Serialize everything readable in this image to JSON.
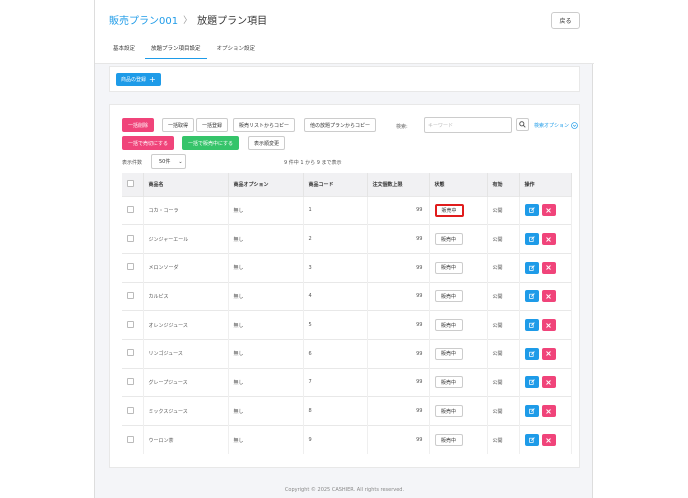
{
  "breadcrumb": {
    "parent": "販売プラン001",
    "separator": "〉",
    "current": "放題プラン項目"
  },
  "back_label": "戻る",
  "tabs": [
    {
      "label": "基本設定"
    },
    {
      "label": "放題プラン項目設定"
    },
    {
      "label": "オプション設定"
    }
  ],
  "register_button": {
    "label": "商品の登録",
    "icon": "plus-icon"
  },
  "toolbar": {
    "bulk_delete": "一括削除",
    "bulk_fetch": "一括取得",
    "bulk_register": "一括登録",
    "copy_from_sales_list": "販売リストからコピー",
    "copy_from_other_plan": "他の放題プランからコピー",
    "bulk_sold_out": "一括で売切にする",
    "bulk_on_sale": "一括で販売中にする",
    "reorder": "表示順変更"
  },
  "search": {
    "label": "検索:",
    "placeholder": "キーワード",
    "options_label": "検索オプション"
  },
  "display_count": {
    "label": "表示件数",
    "value": "50件"
  },
  "result_summary": "9 件中 1 から 9 まで表示",
  "table": {
    "headers": [
      "",
      "商品名",
      "商品オプション",
      "商品コード",
      "注文個数上限",
      "状態",
      "有効",
      "操作"
    ],
    "rows": [
      {
        "name": "コカ・コーラ",
        "option": "無し",
        "code": "1",
        "limit": "99",
        "status": "販売中",
        "active": "公開"
      },
      {
        "name": "ジンジャーエール",
        "option": "無し",
        "code": "2",
        "limit": "99",
        "status": "販売中",
        "active": "公開"
      },
      {
        "name": "メロンソーダ",
        "option": "無し",
        "code": "3",
        "limit": "99",
        "status": "販売中",
        "active": "公開"
      },
      {
        "name": "カルピス",
        "option": "無し",
        "code": "4",
        "limit": "99",
        "status": "販売中",
        "active": "公開"
      },
      {
        "name": "オレンジジュース",
        "option": "無し",
        "code": "5",
        "limit": "99",
        "status": "販売中",
        "active": "公開"
      },
      {
        "name": "リンゴジュース",
        "option": "無し",
        "code": "6",
        "limit": "99",
        "status": "販売中",
        "active": "公開"
      },
      {
        "name": "グレープジュース",
        "option": "無し",
        "code": "7",
        "limit": "99",
        "status": "販売中",
        "active": "公開"
      },
      {
        "name": "ミックスジュース",
        "option": "無し",
        "code": "8",
        "limit": "99",
        "status": "販売中",
        "active": "公開"
      },
      {
        "name": "ウーロン茶",
        "option": "無し",
        "code": "9",
        "limit": "99",
        "status": "販売中",
        "active": "公開"
      }
    ]
  },
  "colors": {
    "accent": "#1e9be8",
    "danger": "#f0447a",
    "success": "#35c46a",
    "highlight": "#e01c1c"
  },
  "footer": "Copyright © 2025 CASHIER. All rights reserved."
}
